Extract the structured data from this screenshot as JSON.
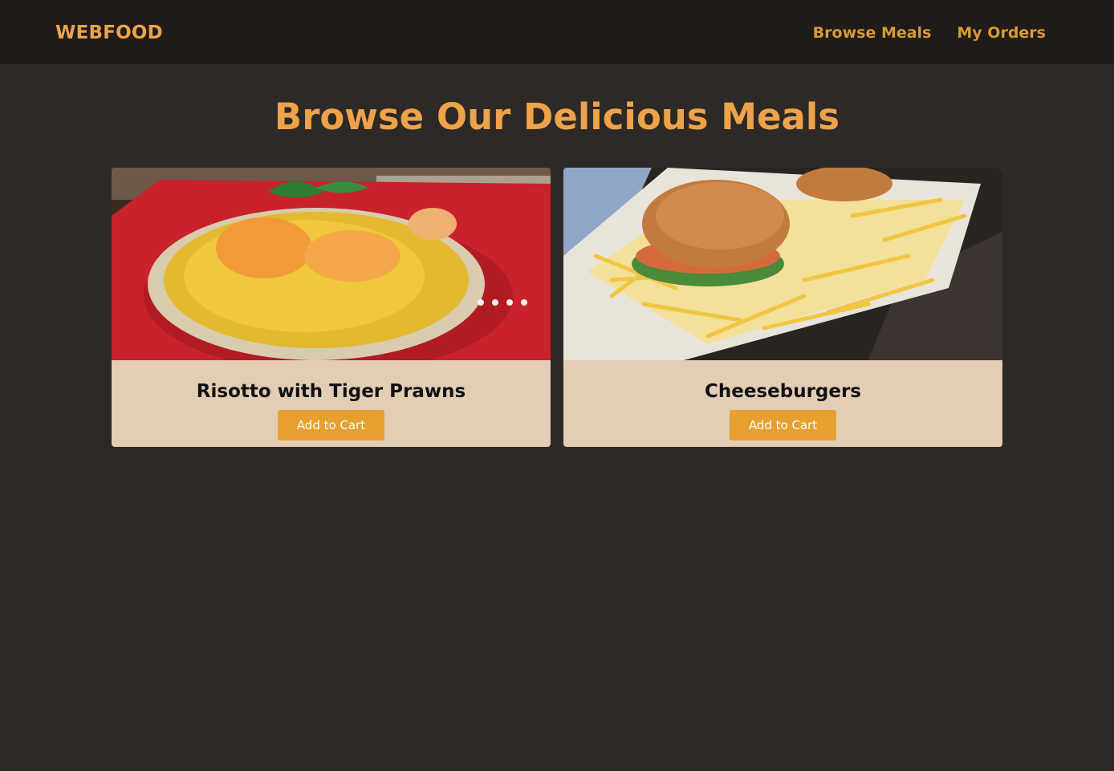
{
  "header": {
    "logo": "WEBFOOD",
    "nav": [
      {
        "label": "Browse Meals"
      },
      {
        "label": "My Orders"
      }
    ]
  },
  "main": {
    "title": "Browse Our Delicious Meals",
    "meals": [
      {
        "name": "Risotto with Tiger Prawns",
        "button_label": "Add to Cart",
        "image": "risotto-photo"
      },
      {
        "name": "Cheeseburgers",
        "button_label": "Add to Cart",
        "image": "cheeseburger-photo"
      }
    ]
  },
  "colors": {
    "background": "#2d2926",
    "header": "#1e1b19",
    "accent": "#eea24a",
    "nav_link": "#d99a30",
    "card": "#e3cdb4",
    "button": "#e6a030"
  }
}
